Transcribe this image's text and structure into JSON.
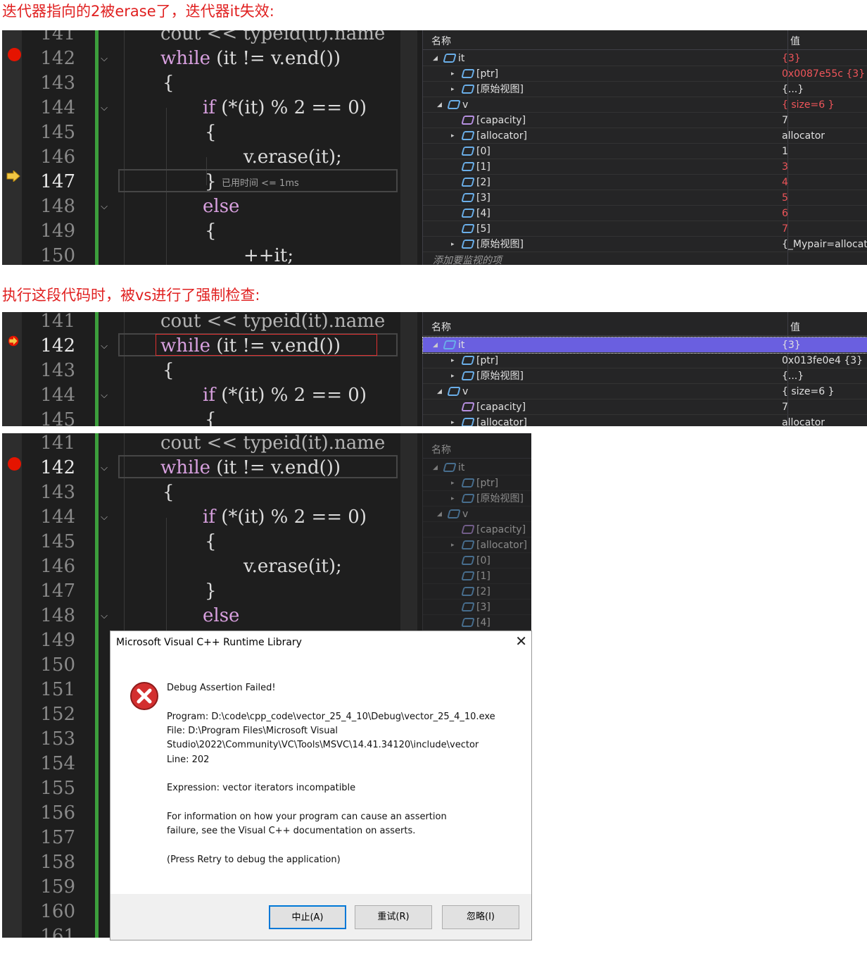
{
  "heading1": "迭代器指向的2被erase了，迭代器it失效:",
  "heading2": "执行这段代码时，被vs进行了强制检查:",
  "panel": {
    "col_name": "名称",
    "col_value": "值",
    "add_watch": "添加要监视的项"
  },
  "shot1": {
    "lines": [
      "141",
      "142",
      "143",
      "144",
      "145",
      "146",
      "147",
      "148",
      "149",
      "150"
    ],
    "code": {
      "l141": "cout << typeid(it).name",
      "l142_kw": "while",
      "l142_rest": " (it != v.end())",
      "l143": "{",
      "l144_kw": "if",
      "l144_rest": " (*(it) % 2 == 0)",
      "l145": "{",
      "l146": "v.erase(it);",
      "l147": "}",
      "l148": "else",
      "l149": "{",
      "l150": "++it;"
    },
    "elapsed": "已用时间 <= 1ms",
    "watch": [
      {
        "name": "it",
        "value": "{3}"
      },
      {
        "name": "[ptr]",
        "value": "0x0087e55c {3}"
      },
      {
        "name": "[原始视图]",
        "value": "{...}"
      },
      {
        "name": "v",
        "value": "{ size=6 }"
      },
      {
        "name": "[capacity]",
        "value": "7"
      },
      {
        "name": "[allocator]",
        "value": "allocator"
      },
      {
        "name": "[0]",
        "value": "1"
      },
      {
        "name": "[1]",
        "value": "3"
      },
      {
        "name": "[2]",
        "value": "4"
      },
      {
        "name": "[3]",
        "value": "5"
      },
      {
        "name": "[4]",
        "value": "6"
      },
      {
        "name": "[5]",
        "value": "7"
      },
      {
        "name": "[原始视图]",
        "value": "{_Mypair=allocat"
      }
    ]
  },
  "shot2": {
    "lines": [
      "141",
      "142",
      "143",
      "144",
      "145"
    ],
    "watch": [
      {
        "name": "it",
        "value": "{3}"
      },
      {
        "name": "[ptr]",
        "value": "0x013fe0e4 {3}"
      },
      {
        "name": "[原始视图]",
        "value": "{...}"
      },
      {
        "name": "v",
        "value": "{ size=6 }"
      },
      {
        "name": "[capacity]",
        "value": "7"
      },
      {
        "name": "[allocator]",
        "value": "allocator"
      }
    ]
  },
  "shot3": {
    "lines": [
      "141",
      "142",
      "143",
      "144",
      "145",
      "146",
      "147",
      "148",
      "149",
      "150",
      "151",
      "152",
      "153",
      "154",
      "155",
      "156",
      "157",
      "158",
      "159",
      "160",
      "161"
    ],
    "watch": [
      "it",
      "[ptr]",
      "[原始视图]",
      "v",
      "[capacity]",
      "[allocator]",
      "[0]",
      "[1]",
      "[2]",
      "[3]",
      "[4]"
    ]
  },
  "dialog": {
    "title": "Microsoft Visual C++ Runtime Library",
    "close": "✕",
    "header": "Debug Assertion Failed!",
    "program": "Program: D:\\code\\cpp_code\\vector_25_4_10\\Debug\\vector_25_4_10.exe",
    "file1": "File: D:\\Program Files\\Microsoft Visual",
    "file2": "Studio\\2022\\Community\\VC\\Tools\\MSVC\\14.41.34120\\include\\vector",
    "line": "Line: 202",
    "expression": "Expression: vector iterators incompatible",
    "info1": "For information on how your program can cause an assertion",
    "info2": "failure, see the Visual C++ documentation on asserts.",
    "press": "(Press Retry to debug the application)",
    "abort": "中止(A)",
    "retry": "重试(R)",
    "ignore": "忽略(I)"
  }
}
